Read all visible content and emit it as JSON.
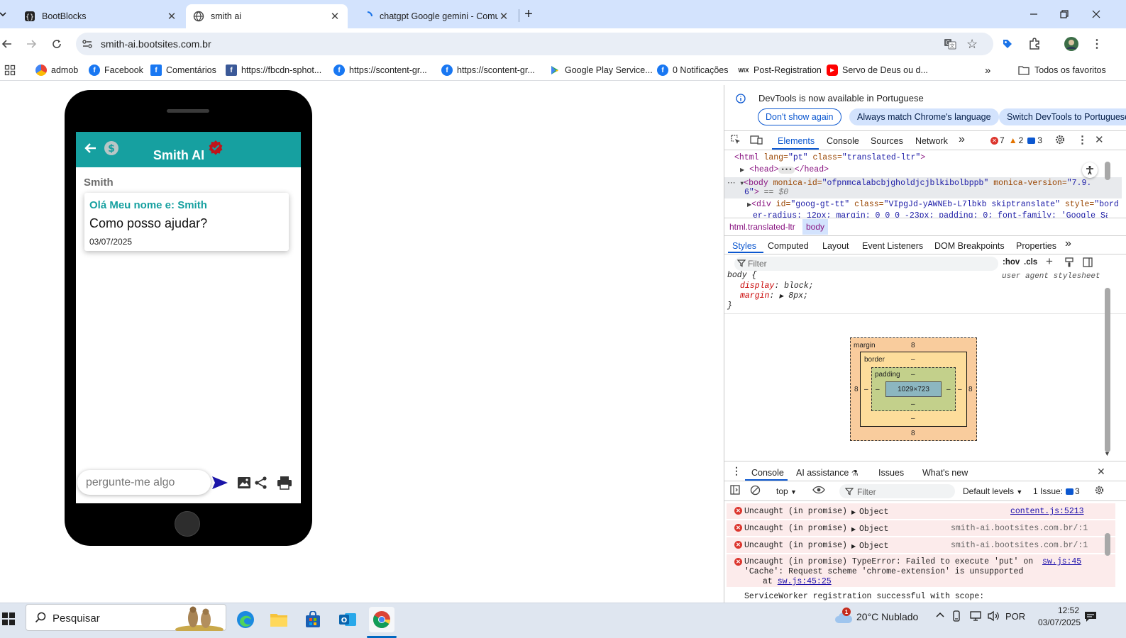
{
  "browser": {
    "tabs": [
      {
        "title": "BootBlocks",
        "active": false
      },
      {
        "title": "smith ai",
        "active": true
      },
      {
        "title": "chatgpt Google gemini - Comu",
        "active": false
      }
    ],
    "url": "smith-ai.bootsites.com.br",
    "bookmarks": [
      {
        "label": "admob",
        "icon": "admob-icon"
      },
      {
        "label": "Facebook",
        "icon": "facebook-icon"
      },
      {
        "label": "Comentários",
        "icon": "facebook-square-icon"
      },
      {
        "label": "https://fbcdn-sphot...",
        "icon": "facebook-square-icon"
      },
      {
        "label": "https://scontent-gr...",
        "icon": "facebook-icon"
      },
      {
        "label": "https://scontent-gr...",
        "icon": "facebook-icon"
      },
      {
        "label": "Google Play Service...",
        "icon": "google-play-icon"
      },
      {
        "label": "0 Notificações",
        "icon": "facebook-icon"
      },
      {
        "label": "Post-Registration",
        "icon": "wix-icon"
      },
      {
        "label": "Servo de Deus ou d...",
        "icon": "youtube-icon"
      }
    ],
    "all_bookmarks": "Todos os favoritos"
  },
  "app": {
    "title": "Smith AI",
    "sender": "Smith",
    "greeting": "Olá Meu nome e: Smith",
    "question": "Como posso ajudar?",
    "date": "03/07/2025",
    "input_placeholder": "pergunte-me algo",
    "colors": {
      "header": "#16a0a0",
      "accent": "#16a0a0",
      "verified": "#c0141a",
      "send": "#1a14a8"
    }
  },
  "devtools": {
    "banner_text": "DevTools is now available in Portuguese",
    "banner_buttons": [
      "Don't show again",
      "Always match Chrome's language",
      "Switch DevTools to Portuguese"
    ],
    "main_tabs": [
      "Elements",
      "Console",
      "Sources",
      "Network"
    ],
    "counts": {
      "errors": "7",
      "warnings": "2",
      "messages": "3"
    },
    "dom": {
      "line1_tag": "<html",
      "line1_attr": "lang=",
      "line1_val": "\"pt\"",
      "line1_attr2": "class=",
      "line1_val2": "\"translated-ltr\"",
      "line2": "<head>",
      "line2_end": "</head>",
      "line3_attr": "monica-id=",
      "line3_val": "\"ofpnmcalabcbjgholdjcjblkibolbppb\"",
      "line3_attr2": "monica-version=",
      "line3_val2": "\"7.9.",
      "line4_val": "6\"",
      "line4_rest": "== $0",
      "line5_attr": "id=",
      "line5_val": "\"goog-gt-tt\"",
      "line5_attr2": "class=",
      "line5_val2": "\"VIpgJd-yAWNEb-L7lbkb skiptranslate\"",
      "line5_attr3": "style=",
      "line5_val3": "\"bord",
      "line6": "er-radius: 12px; margin: 0 0 0 -23px; padding: 0; font-family: 'Google San"
    },
    "breadcrumbs": [
      "html.translated-ltr",
      "body"
    ],
    "sub_tabs": [
      "Styles",
      "Computed",
      "Layout",
      "Event Listeners",
      "DOM Breakpoints",
      "Properties"
    ],
    "filter_placeholder": "Filter",
    "hov": ":hov",
    "cls": ".cls",
    "style_rule": {
      "selector": "body {",
      "source": "user agent stylesheet",
      "decl1_prop": "display",
      "decl1_val": "block;",
      "decl2_prop": "margin",
      "decl2_val": "8px;",
      "close": "}"
    },
    "box_model": {
      "margin_label": "margin",
      "border_label": "border",
      "padding_label": "padding",
      "margin": "8",
      "border": "–",
      "padding": "–",
      "content": "1029×723"
    },
    "drawer_tabs": [
      "Console",
      "AI assistance",
      "Issues",
      "What's new"
    ],
    "console_context": "top",
    "console_filter": "Filter",
    "default_levels": "Default levels",
    "issues_label": "1 Issue:",
    "issues_count": "3",
    "messages": [
      {
        "text": "Uncaught (in promise)",
        "obj": "Object",
        "source": "content.js:5213"
      },
      {
        "text": "Uncaught (in promise)",
        "obj": "Object",
        "source": "smith-ai.bootsites.com.br/:1"
      },
      {
        "text": "Uncaught (in promise)",
        "obj": "Object",
        "source": "smith-ai.bootsites.com.br/:1"
      }
    ],
    "type_error": {
      "line1": "Uncaught (in promise) TypeError: Failed to execute 'put' on",
      "line2": "'Cache': Request scheme 'chrome-extension' is unsupported",
      "at": "at",
      "at_link": "sw.js:45:25",
      "source": "sw.js:45"
    },
    "sw_message": "ServiceWorker registration successful with scope:"
  },
  "taskbar": {
    "search_placeholder": "Pesquisar",
    "weather": "20°C Nublado",
    "lang": "POR",
    "time": "12:52",
    "date": "03/07/2025",
    "notification_badge": "1"
  }
}
